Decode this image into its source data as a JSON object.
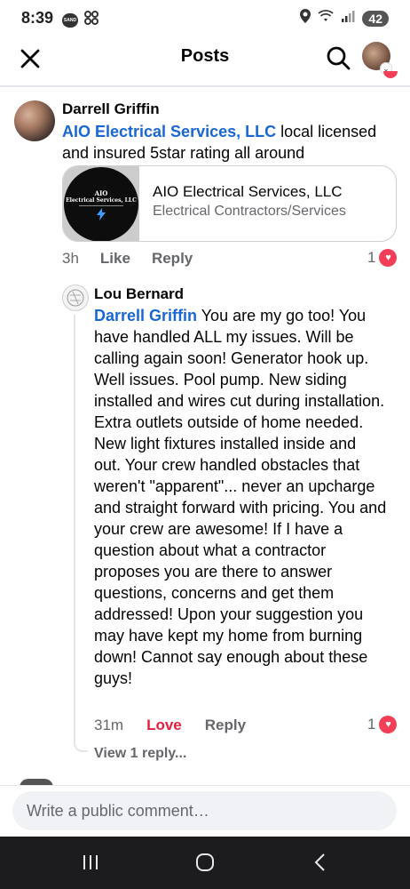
{
  "status_bar": {
    "time": "8:39",
    "battery": "42",
    "pill_label": "SAND"
  },
  "header": {
    "title": "Posts"
  },
  "comments": [
    {
      "author": "Darrell Griffin",
      "mention": "AIO Electrical Services, LLC",
      "text": " local licensed and insured 5star rating all around",
      "link_card": {
        "title": "AIO Electrical Services, LLC",
        "subtitle": "Electrical Contractors/Services",
        "logo_line1": "AIO",
        "logo_line2": "Electrical Services, LLC"
      },
      "time": "3h",
      "like_label": "Like",
      "reply_label": "Reply",
      "reaction_count": "1"
    },
    {
      "author": "Lou Bernard",
      "mention": "Darrell Griffin",
      "text": " You are my go too! You have handled ALL  my issues. Will be calling again soon! Generator hook up. Well issues. Pool pump. New siding installed and wires cut during installation.  Extra outlets outside of home needed. New light fixtures installed inside and out. Your crew handled obstacles that weren't \"apparent\"... never an upcharge and straight forward with pricing.  You and your crew are awesome! If I have a question about what a contractor proposes  you are there to answer questions, concerns and get them addressed! Upon your suggestion you may have kept my home from burning down! Cannot say enough about these guys!",
      "time": "31m",
      "like_label": "Love",
      "reply_label": "Reply",
      "reaction_count": "1",
      "view_replies": "View 1 reply..."
    }
  ],
  "composer": {
    "placeholder": "Write a public comment…"
  },
  "colors": {
    "link_blue": "#1967d2",
    "love_red": "#e41e3f",
    "heart_bg": "#f33e58",
    "muted": "#65676b"
  }
}
